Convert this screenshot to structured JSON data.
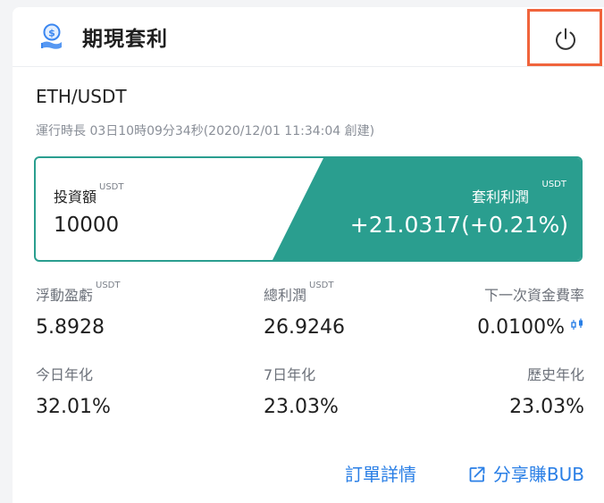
{
  "header": {
    "title": "期現套利",
    "icon": "dollar-coin-hand-icon",
    "power_icon": "power-icon"
  },
  "pair": "ETH/USDT",
  "runtime": "運行時長 03日10時09分34秒(2020/12/01 11:34:04 創建)",
  "summary": {
    "investment_label": "投資額",
    "investment_unit": "USDT",
    "investment_value": "10000",
    "profit_label": "套利利潤",
    "profit_unit": "USDT",
    "profit_value": "+21.0317(+0.21%)"
  },
  "stats": {
    "floating_pnl": {
      "label": "浮動盈虧",
      "unit": "USDT",
      "value": "5.8928"
    },
    "total_profit": {
      "label": "總利潤",
      "unit": "USDT",
      "value": "26.9246"
    },
    "next_funding_rate": {
      "label": "下一次資金費率",
      "value": "0.0100%",
      "icon": "candlestick-icon"
    },
    "today_annualized": {
      "label": "今日年化",
      "value": "32.01%"
    },
    "seven_day_annualized": {
      "label": "7日年化",
      "value": "23.03%"
    },
    "historical_annualized": {
      "label": "歷史年化",
      "value": "23.03%"
    }
  },
  "footer": {
    "order_details": "訂單詳情",
    "share_label": "分享賺BUB",
    "share_icon": "share-external-icon"
  },
  "colors": {
    "teal": "#2a9e8f",
    "link_blue": "#2a7fe6",
    "highlight_orange": "#f0643c"
  }
}
